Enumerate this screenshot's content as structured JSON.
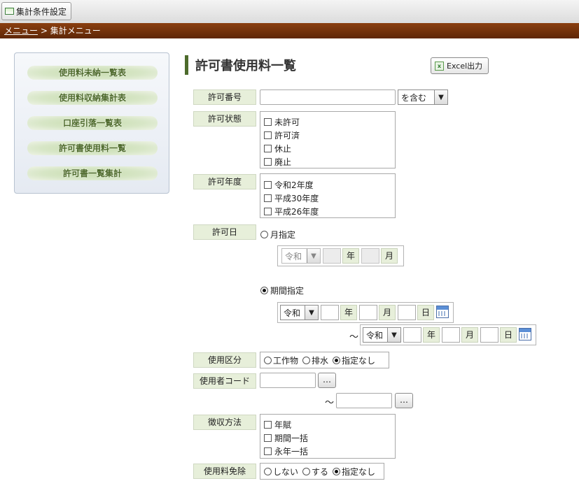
{
  "toolbar": {
    "button_label": "集計条件設定"
  },
  "breadcrumb": {
    "link": "メニュー",
    "sep": " > ",
    "current": "集計メニュー"
  },
  "sidebar": {
    "items": [
      "使用料未納一覧表",
      "使用料収納集計表",
      "口座引落一覧表",
      "許可書使用料一覧",
      "許可書一覧集計"
    ]
  },
  "page": {
    "title": "許可書使用料一覧",
    "excel_label": "Excel出力"
  },
  "form": {
    "permit_no": {
      "label": "許可番号",
      "value": "",
      "match": "を含む"
    },
    "permit_status": {
      "label": "許可状態",
      "options": [
        "未許可",
        "許可済",
        "休止",
        "廃止"
      ]
    },
    "permit_year": {
      "label": "許可年度",
      "options": [
        "令和2年度",
        "平成30年度",
        "平成26年度"
      ]
    },
    "permit_date": {
      "label": "許可日",
      "mode_month": "月指定",
      "mode_range": "期間指定",
      "selected": "期間指定",
      "era": "令和",
      "year_unit": "年",
      "month_unit": "月",
      "day_unit": "日",
      "tilde": "～"
    },
    "usage_class": {
      "label": "使用区分",
      "options": [
        "工作物",
        "排水",
        "指定なし"
      ],
      "selected": "指定なし"
    },
    "user_code": {
      "label": "使用者コード",
      "dots": "…",
      "tilde": "～"
    },
    "collection": {
      "label": "徴収方法",
      "options": [
        "年賦",
        "期間一括",
        "永年一括"
      ]
    },
    "exemption": {
      "label": "使用料免除",
      "options": [
        "しない",
        "する",
        "指定なし"
      ],
      "selected": "指定なし"
    }
  }
}
